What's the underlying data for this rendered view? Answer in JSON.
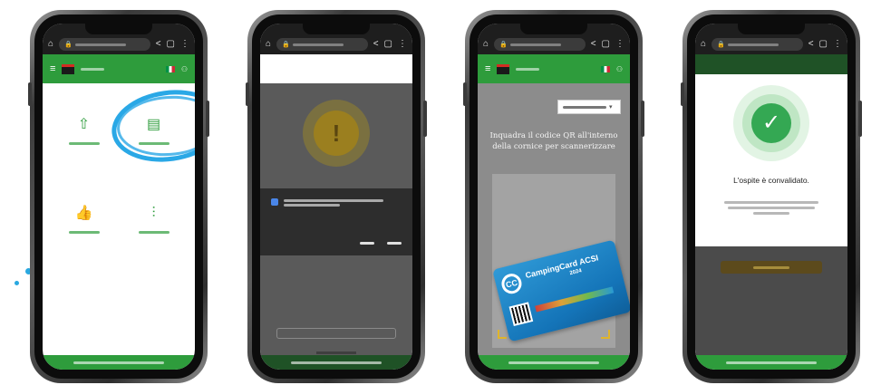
{
  "theme": {
    "brand_green": "#2e9c3c",
    "highlight_blue": "#2aa8e6",
    "success_green": "#34a853",
    "warning_yellow": "#d8b12a"
  },
  "icons": {
    "chrome": [
      "home-icon",
      "lock-icon",
      "share-icon",
      "tabs-icon",
      "more-vert-icon"
    ],
    "app_header": [
      "menu-icon",
      "flag-italy-icon",
      "user-icon"
    ],
    "screen1": [
      "upload-icon",
      "scan-document-icon",
      "thumbs-up-icon",
      "sliders-icon"
    ],
    "screen2": [
      "warning-icon"
    ],
    "screen4": [
      "checkmark-icon"
    ]
  },
  "screen3": {
    "instruction": "Inquadra il codice QR all'interno della cornice per scannerizzare",
    "card": {
      "brand": "CampingCard ACSI",
      "logo": "CC",
      "year": "2024"
    }
  },
  "screen4": {
    "title": "L'ospite è convalidato."
  }
}
